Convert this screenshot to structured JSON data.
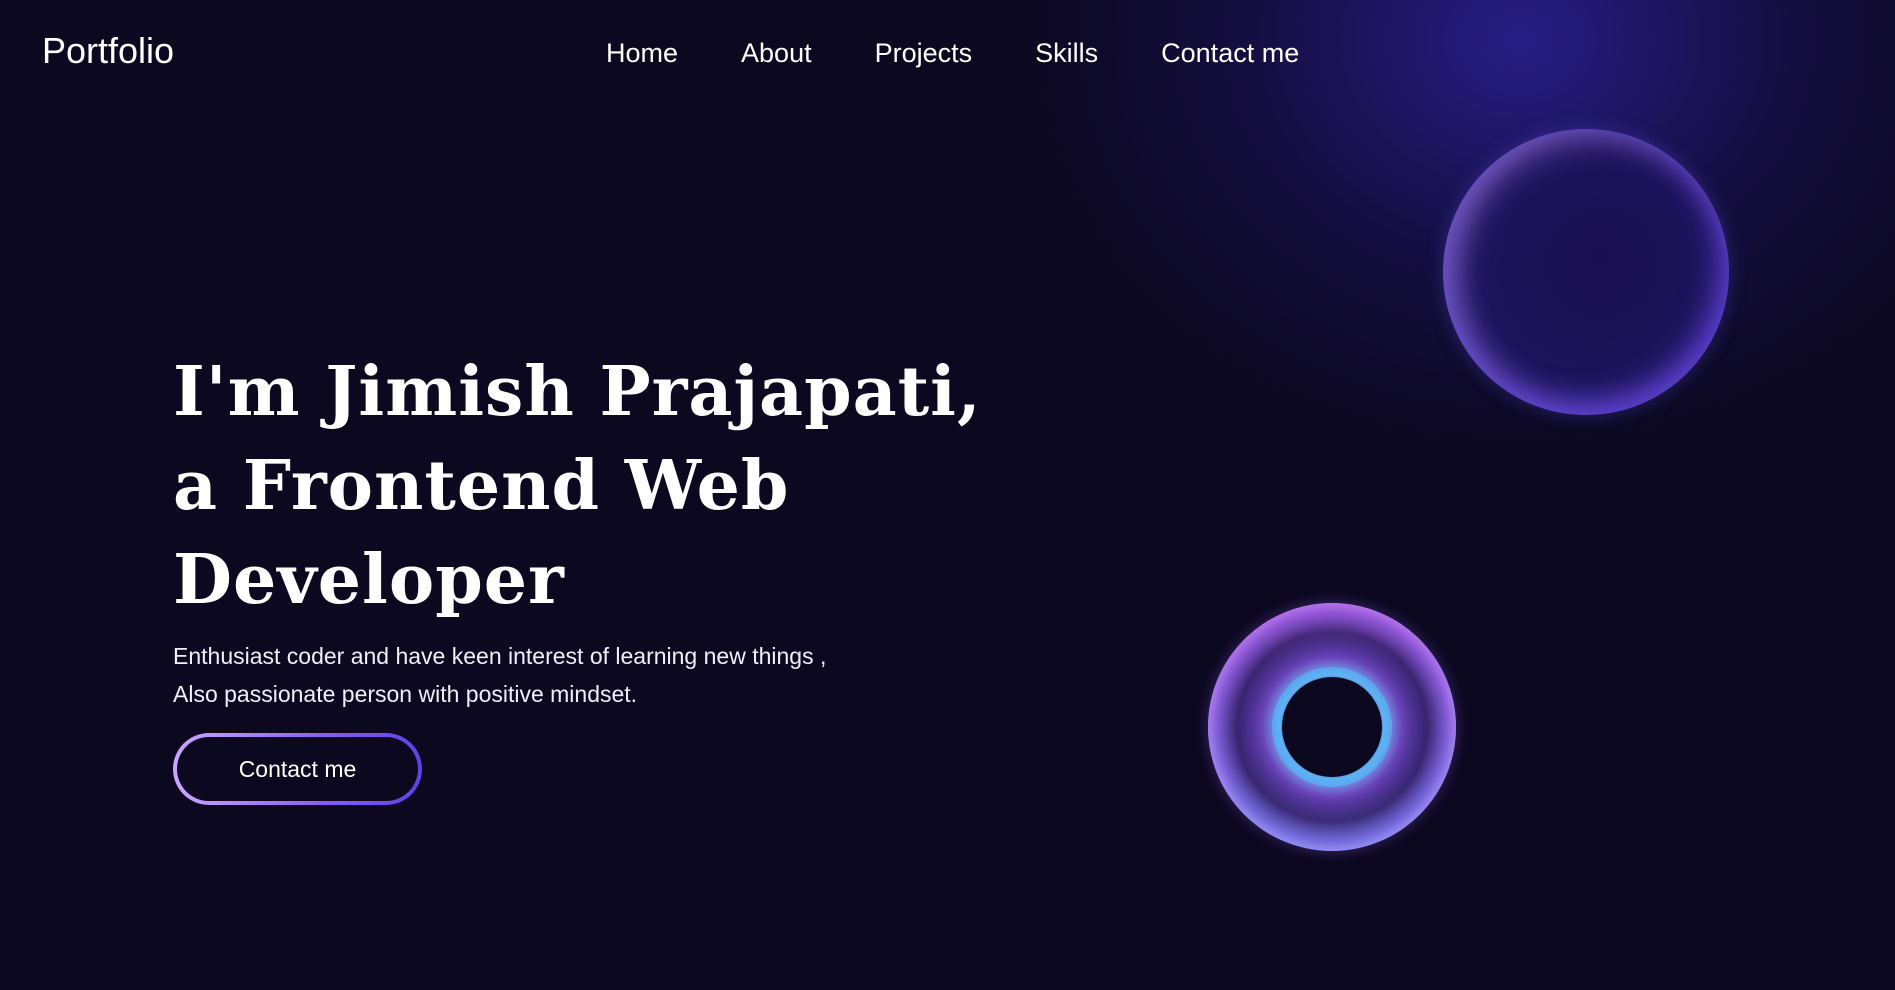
{
  "brand": {
    "logo": "Portfolio"
  },
  "nav": {
    "items": [
      {
        "label": "Home"
      },
      {
        "label": "About"
      },
      {
        "label": "Projects"
      },
      {
        "label": "Skills"
      },
      {
        "label": "Contact me"
      }
    ]
  },
  "hero": {
    "title_lines": [
      "I'm Jimish Prajapati,",
      "a Frontend Web",
      "Developer"
    ],
    "description_lines": [
      "Enthusiast coder and have keen interest of learning new things ,",
      "Also passionate person with positive mindset."
    ],
    "cta_label": "Contact me"
  },
  "colors": {
    "background": "#0c0820",
    "glow": "#2d2096",
    "button_border_start": "#c9a6ff",
    "button_border_end": "#5b42e8"
  }
}
